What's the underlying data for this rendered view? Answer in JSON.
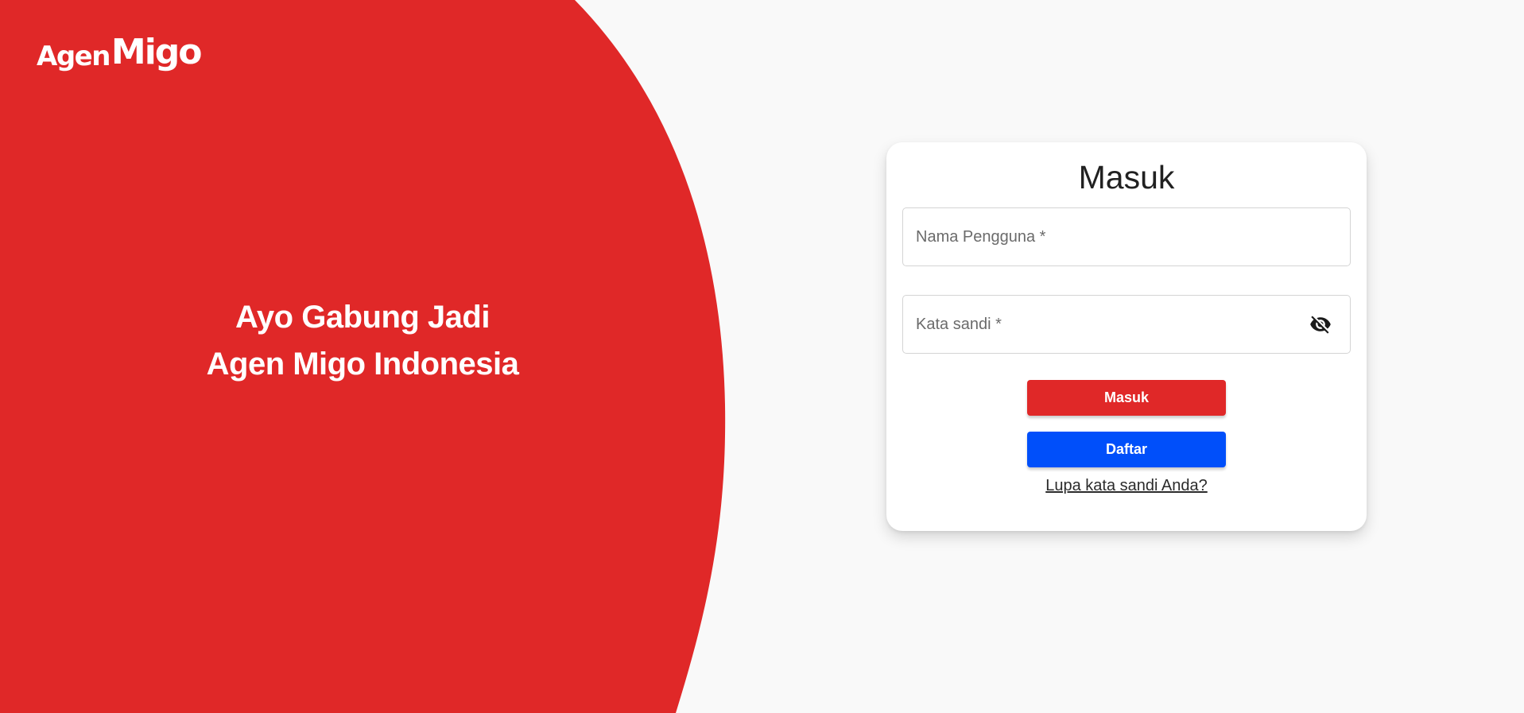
{
  "colors": {
    "background": "#f9f9f9",
    "hero_red": "#e02828",
    "card_background": "#ffffff",
    "login_button": "#e02828",
    "register_button": "#004ffa",
    "text_dark": "#212121"
  },
  "brand": {
    "logo_part_1": "Agen",
    "logo_part_2": "Migo"
  },
  "hero": {
    "line_1": "Ayo Gabung Jadi",
    "line_2": "Agen Migo Indonesia"
  },
  "login_card": {
    "title": "Masuk",
    "username_field": {
      "placeholder": "Nama Pengguna *",
      "value": ""
    },
    "password_field": {
      "placeholder": "Kata sandi *",
      "value": "",
      "toggle_icon": "eye-off-icon"
    },
    "login_button_label": "Masuk",
    "register_button_label": "Daftar",
    "forgot_password_label": "Lupa kata sandi Anda?"
  }
}
